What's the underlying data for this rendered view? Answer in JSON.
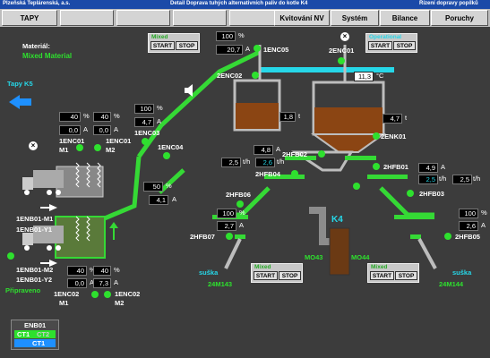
{
  "titlebar": {
    "company": "Plzeňská Teplárenská, a.s.",
    "title": "Detail Doprava tuhých alternativních paliv do kotle K4",
    "system": "Řízení dopravy popílků"
  },
  "menu": {
    "tapy": "TAPY",
    "kvitovani": "Kvitování NV",
    "system": "Systém",
    "bilance": "Bilance",
    "poruchy": "Poruchy"
  },
  "material": {
    "label": "Materiál:",
    "value": "Mixed Material"
  },
  "nav": {
    "tapy_k5": "Tapy K5"
  },
  "ctrl": {
    "start": "START",
    "stop": "STOP",
    "top_left": "Mixed",
    "top_right": "Operational",
    "bottom_left": "Mixed",
    "bottom_right": "Mixed"
  },
  "values": {
    "enc01_pct_a": "40",
    "enc01_pct_b": "40",
    "enc01_a_a": "0,0",
    "enc01_a_b": "0,0",
    "enc03_pct": "100",
    "enc03_a": "4,7",
    "enc04_pct": "50",
    "enc04_a": "4,1",
    "enc05_pct": "100",
    "enc05_a": "20,7",
    "temp": "11,3",
    "t_left": "1,8",
    "t_right": "4,7",
    "hfb02_a": "4,8",
    "hfb02_th_a": "2,5",
    "hfb02_th_b": "2,6",
    "hfb01_a": "4,9",
    "hfb01_th_a": "2,5",
    "hfb01_th_b": "2,5",
    "hfb07_pct": "100",
    "hfb07_a": "2,7",
    "hfb05_pct": "100",
    "hfb05_a": "2,6",
    "enc02_pct_a": "40",
    "enc02_pct_b": "40",
    "enc02_a_a": "0,0",
    "enc02_a_b": "7,3"
  },
  "units": {
    "pct": "%",
    "amp": "A",
    "ton": "t",
    "th": "t/h",
    "celsius": "°C"
  },
  "labels": {
    "enc05": "1ENC05",
    "enc01": "2ENC01",
    "enc02": "2ENC02",
    "enc01_m1": "1ENC01",
    "m1": "M1",
    "enc01_m2": "1ENC01",
    "m2": "M2",
    "enc03": "1ENC03",
    "enc04": "1ENC04",
    "enk01": "2ENK01",
    "hfb02": "2HFB02",
    "hfb04": "2HFB04",
    "hfb01": "2HFB01",
    "hfb03": "2HFB03",
    "hfb06": "2HFB06",
    "hfb07": "2HFB07",
    "hfb05": "2HFB05",
    "k4": "K4",
    "mo43": "MO43",
    "mo44": "MO44",
    "suska": "suška",
    "m143": "24M143",
    "m144": "24M144",
    "enb01_m1": "1ENB01-M1",
    "enb01_y1": "1ENB01-Y1",
    "enb01_m2": "1ENB01-M2",
    "enb01_y2": "1ENB01-Y2",
    "pripraveno": "Připraveno",
    "enc02_m1": "1ENC02",
    "enc02_m2": "1ENC02"
  },
  "legend": {
    "title": "ENB01",
    "ct1": "CT1",
    "ct2": "CT2",
    "ct1b": "CT1"
  }
}
